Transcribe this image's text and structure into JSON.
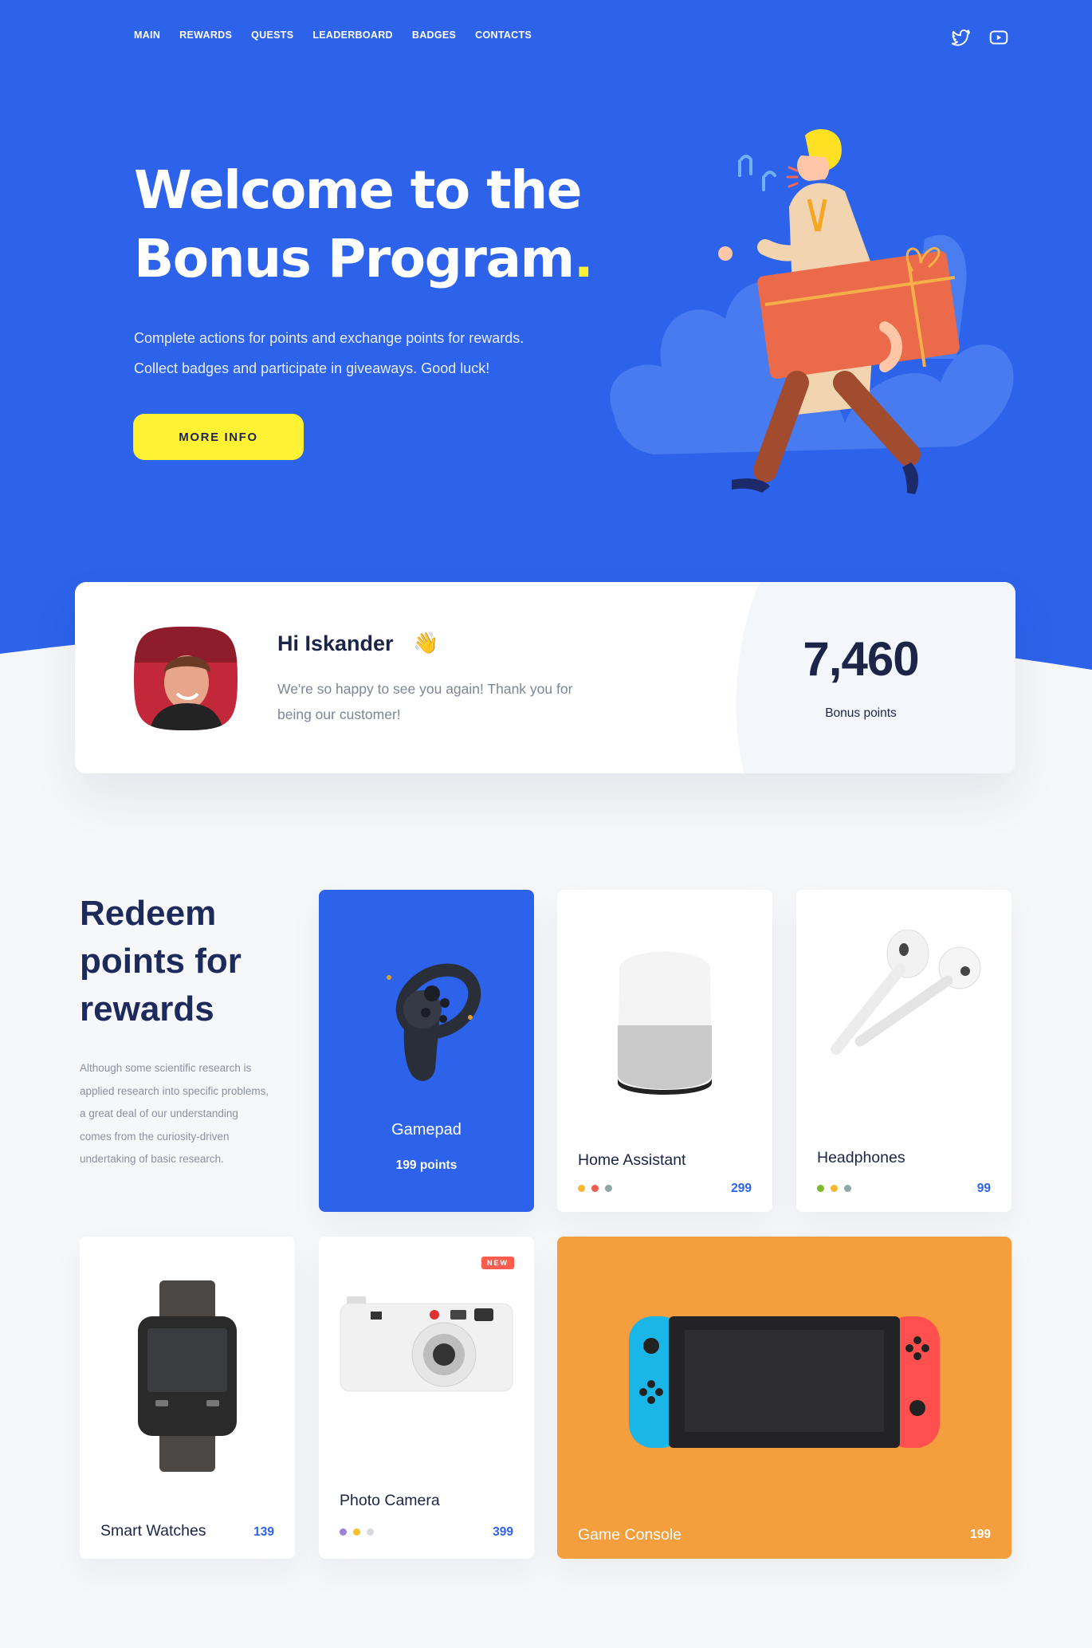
{
  "nav": {
    "items": [
      "MAIN",
      "REWARDS",
      "QUESTS",
      "LEADERBOARD",
      "BADGES",
      "CONTACTS"
    ],
    "social": [
      "twitter-icon",
      "youtube-icon"
    ]
  },
  "hero": {
    "title_line1": "Welcome to the",
    "title_line2": "Bonus Program",
    "title_dot": ".",
    "desc_line1": "Complete actions for points and exchange points for rewards.",
    "desc_line2": "Collect badges and participate in giveaways. Good luck!",
    "button": "MORE INFO"
  },
  "user": {
    "greeting": "Hi Iskander",
    "wave": "👋",
    "message": "We're so happy to see you again! Thank you for being our customer!",
    "points": "7,460",
    "points_label": "Bonus points"
  },
  "rewards": {
    "title": "Redeem points for rewards",
    "description": "Although some scientific research is applied research into specific problems, a great deal of our understanding comes from the curiosity-driven undertaking of basic research.",
    "items": [
      {
        "name": "Gamepad",
        "price": "199 points"
      },
      {
        "name": "Home Assistant",
        "price": "299",
        "dots": [
          "#f5b82e",
          "#f05a4f",
          "#8fa6a6"
        ]
      },
      {
        "name": "Headphones",
        "price": "99",
        "dots": [
          "#7cb82b",
          "#f5b82e",
          "#8fa6a6"
        ]
      },
      {
        "name": "Smart Watches",
        "price": "139"
      },
      {
        "name": "Photo Camera",
        "price": "399",
        "badge": "NEW",
        "dots": [
          "#9b82d6",
          "#f5c22e",
          "#d6d9de"
        ]
      },
      {
        "name": "Game Console",
        "price": "199"
      }
    ]
  },
  "colors": {
    "accent": "#2d62ea",
    "yellow": "#fff134",
    "orange": "#f59e3d"
  }
}
